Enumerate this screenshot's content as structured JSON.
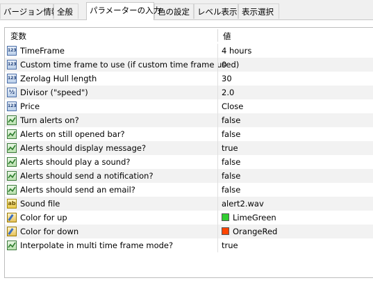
{
  "tabs": [
    {
      "label": "バージョン情報",
      "active": false
    },
    {
      "label": "全般",
      "active": false
    },
    {
      "label": "パラメーターの入力",
      "active": true
    },
    {
      "label": "色の設定",
      "active": false
    },
    {
      "label": "レベル表示",
      "active": false
    },
    {
      "label": "表示選択",
      "active": false
    }
  ],
  "grid": {
    "col_variable": "変数",
    "col_value": "値",
    "rows": [
      {
        "icon": "int-icon",
        "icon_text": "123",
        "name": "TimeFrame",
        "value": "4 hours"
      },
      {
        "icon": "int-icon",
        "icon_text": "123",
        "name": "Custom time frame to use (if custom time frame used)",
        "value": "0"
      },
      {
        "icon": "int-icon",
        "icon_text": "123",
        "name": "Zerolag Hull length",
        "value": "30"
      },
      {
        "icon": "double-icon",
        "icon_text": "½",
        "name": "Divisor (\"speed\")",
        "value": "2.0"
      },
      {
        "icon": "int-icon",
        "icon_text": "123",
        "name": "Price",
        "value": "Close"
      },
      {
        "icon": "bool-icon",
        "name": "Turn alerts on?",
        "value": "false"
      },
      {
        "icon": "bool-icon",
        "name": "Alerts on still opened bar?",
        "value": "false"
      },
      {
        "icon": "bool-icon",
        "name": "Alerts should display message?",
        "value": "true"
      },
      {
        "icon": "bool-icon",
        "name": "Alerts should play a sound?",
        "value": "false"
      },
      {
        "icon": "bool-icon",
        "name": "Alerts should send a notification?",
        "value": "false"
      },
      {
        "icon": "bool-icon",
        "name": "Alerts should send an email?",
        "value": "false"
      },
      {
        "icon": "string-icon",
        "icon_text": "ab",
        "name": "Sound file",
        "value": "alert2.wav"
      },
      {
        "icon": "color-icon",
        "name": "Color for up",
        "value": "LimeGreen",
        "swatch": "#32cd32"
      },
      {
        "icon": "color-icon",
        "name": "Color for down",
        "value": "OrangeRed",
        "swatch": "#ff4500"
      },
      {
        "icon": "bool-icon",
        "name": "Interpolate in multi time frame mode?",
        "value": "true"
      }
    ]
  }
}
